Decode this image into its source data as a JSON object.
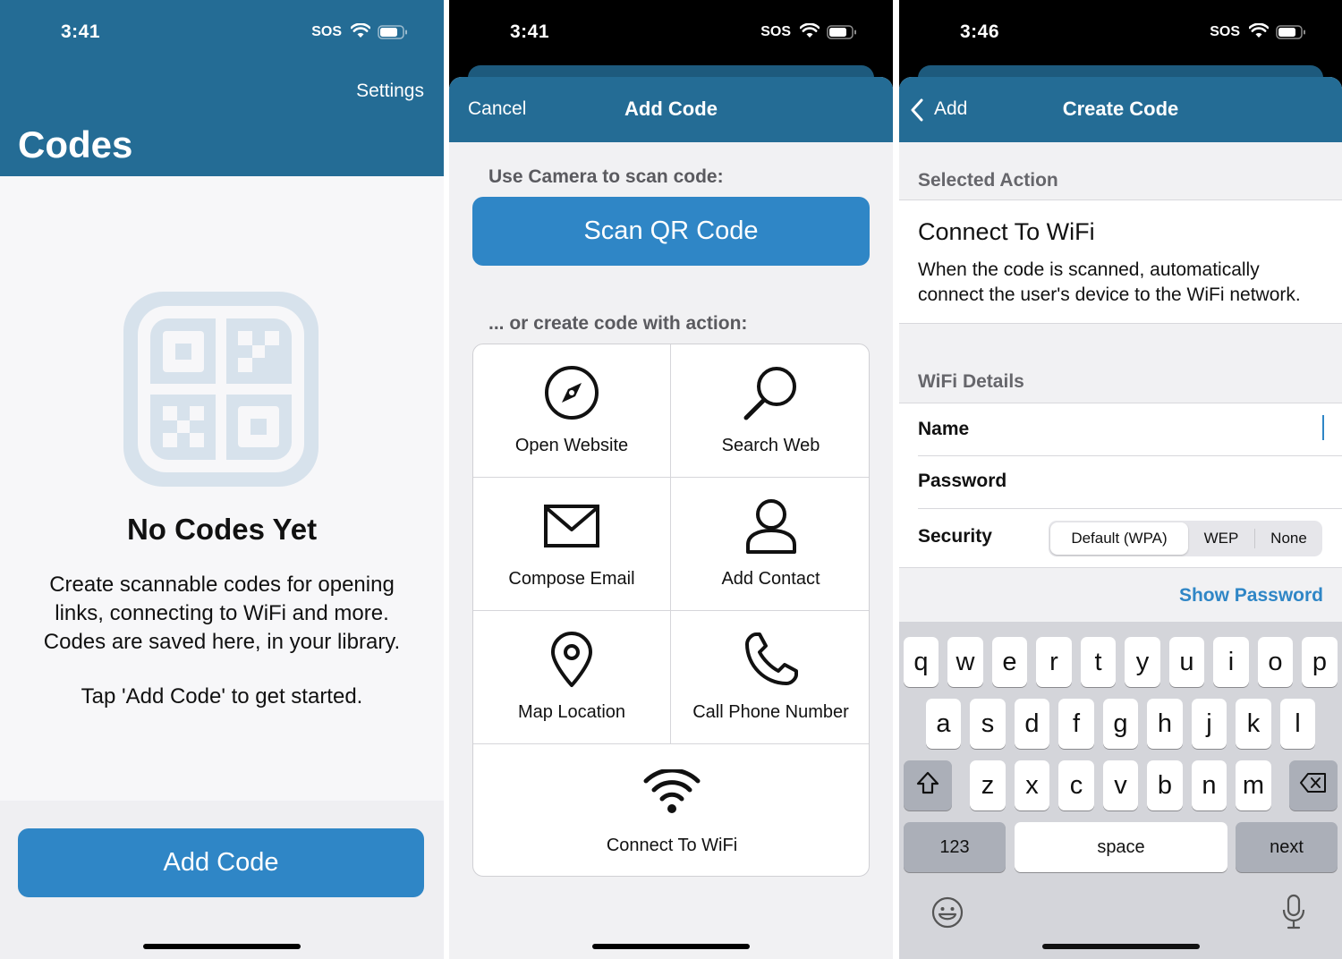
{
  "status_bars": [
    {
      "time": "3:41",
      "signal": "SOS"
    },
    {
      "time": "3:41",
      "signal": "SOS"
    },
    {
      "time": "3:46",
      "signal": "SOS"
    }
  ],
  "colors": {
    "nav_bar": "#246c95",
    "accent_button": "#2f86c6",
    "background": "#f1f1f3"
  },
  "panel1": {
    "settings_label": "Settings",
    "title": "Codes",
    "empty_icon": "qr-code-icon",
    "empty_title": "No Codes Yet",
    "empty_text": "Create scannable codes for opening links, connecting to WiFi and more. Codes are saved here, in your library.",
    "empty_hint": "Tap 'Add Code' to get started.",
    "add_button": "Add Code"
  },
  "panel2": {
    "cancel_label": "Cancel",
    "title": "Add Code",
    "scan_section": "Use Camera to scan code:",
    "scan_button": "Scan QR Code",
    "create_section": "... or create code with action:",
    "actions": [
      {
        "label": "Open Website",
        "icon": "compass-icon"
      },
      {
        "label": "Search Web",
        "icon": "magnifier-icon"
      },
      {
        "label": "Compose Email",
        "icon": "envelope-icon"
      },
      {
        "label": "Add Contact",
        "icon": "person-icon"
      },
      {
        "label": "Map Location",
        "icon": "map-pin-icon"
      },
      {
        "label": "Call Phone Number",
        "icon": "phone-icon"
      },
      {
        "label": "Connect To WiFi",
        "icon": "wifi-icon"
      }
    ]
  },
  "panel3": {
    "back_label": "Add",
    "title": "Create Code",
    "selected_section": "Selected Action",
    "action_title": "Connect To WiFi",
    "action_desc": "When the code is scanned, automatically connect the user's device to the WiFi network.",
    "wifi_section": "WiFi Details",
    "name_label": "Name",
    "password_label": "Password",
    "security_label": "Security",
    "security_options": [
      "Default (WPA)",
      "WEP",
      "None"
    ],
    "security_selected": "Default (WPA)",
    "show_password": "Show Password",
    "keyboard": {
      "row1": [
        "q",
        "w",
        "e",
        "r",
        "t",
        "y",
        "u",
        "i",
        "o",
        "p"
      ],
      "row2": [
        "a",
        "s",
        "d",
        "f",
        "g",
        "h",
        "j",
        "k",
        "l"
      ],
      "row3": [
        "z",
        "x",
        "c",
        "v",
        "b",
        "n",
        "m"
      ],
      "numbers_key": "123",
      "space_key": "space",
      "next_key": "next"
    }
  }
}
